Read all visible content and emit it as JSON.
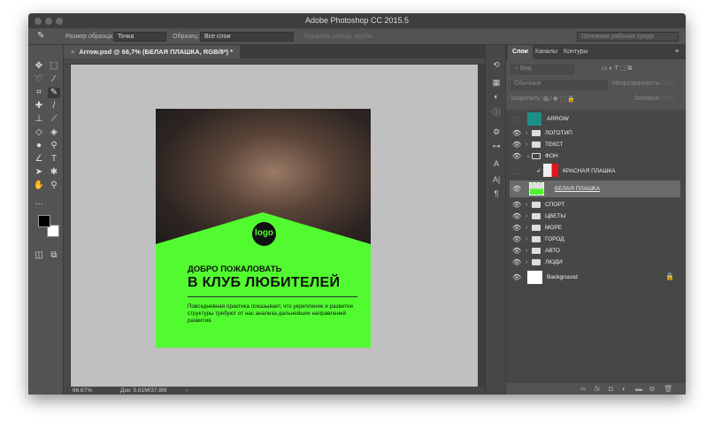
{
  "app": {
    "title": "Adobe Photoshop CC 2015.5"
  },
  "options": {
    "sample_size_label": "Размер образца:",
    "sample_size_value": "Точка",
    "sample_label": "Образец:",
    "sample_value": "Все слои",
    "show_ring": "Показать кольцо пробы",
    "workspace": "Основная рабочая среда"
  },
  "document": {
    "tab": "Arrow.psd @ 66,7% (БЕЛАЯ ПЛАШКА, RGB/8*) *",
    "zoom": "66,67%",
    "doc_size": "Док: 5,61M/37,8M"
  },
  "artwork": {
    "logo": "logo",
    "heading_small": "ДОБРО ПОЖАЛОВАТЬ",
    "heading_large": "В КЛУБ ЛЮБИТЕЛЕЙ",
    "paragraph": "Повседневная практика показывает, что укрепление и развитие структуры требуют от нас анализа дальнейших направлений развития."
  },
  "panel": {
    "tabs": [
      "Слои",
      "Каналы",
      "Контуры"
    ],
    "filter": "Вид",
    "blend": "Обычные",
    "opacity_label": "Непрозрачность:",
    "opacity_value": "100%",
    "lock_label": "Закрепить:",
    "fill_label": "Заливка:",
    "fill_value": "100%",
    "layers": [
      {
        "name": "ARROW",
        "type": "smart",
        "visible": false
      },
      {
        "name": "ЛОГОТИП",
        "type": "group",
        "visible": true
      },
      {
        "name": "ТЕКСТ",
        "type": "group",
        "visible": true
      },
      {
        "name": "ФОН",
        "type": "group-open",
        "visible": true
      },
      {
        "name": "КРАСНАЯ ПЛАШКА",
        "type": "smart-red",
        "visible": false
      },
      {
        "name": "БЕЛАЯ ПЛАШКА",
        "type": "smart-green",
        "visible": true,
        "selected": true
      },
      {
        "name": "СПОРТ",
        "type": "group",
        "visible": true
      },
      {
        "name": "ЦВЕТЫ",
        "type": "group",
        "visible": true
      },
      {
        "name": "МОРЕ",
        "type": "group",
        "visible": true
      },
      {
        "name": "ГОРОД",
        "type": "group",
        "visible": true
      },
      {
        "name": "АВТО",
        "type": "group",
        "visible": true
      },
      {
        "name": "ЛЮДИ",
        "type": "group",
        "visible": true
      },
      {
        "name": "Background",
        "type": "background",
        "visible": true
      }
    ]
  },
  "colors": {
    "accent_green": "#52fb30",
    "teal": "#1e8f86",
    "red": "#e8141a"
  }
}
